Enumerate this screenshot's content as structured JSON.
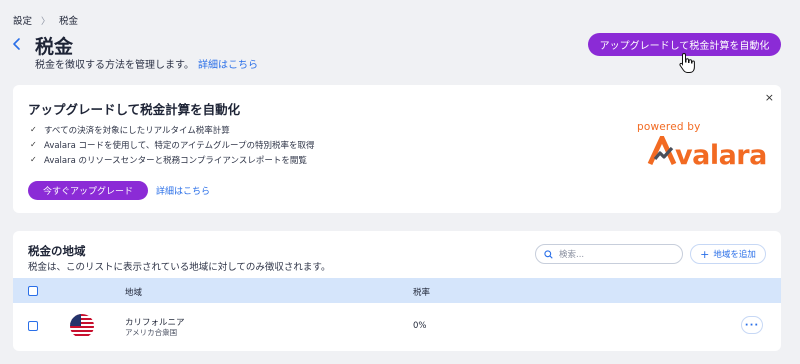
{
  "breadcrumb": {
    "items": [
      "設定",
      "税金"
    ],
    "separator": "〉"
  },
  "header": {
    "title": "税金",
    "subtitle": "税金を徴収する方法を管理します。",
    "learn_more": "詳細はこちら",
    "upgrade_button": "アップグレードして税金計算を自動化"
  },
  "promo": {
    "title": "アップグレードして税金計算を自動化",
    "features": [
      "すべての決済を対象にしたリアルタイム税率計算",
      "Avalara コードを使用して、特定のアイテムグループの特別税率を取得",
      "Avalara のリソースセンターと税務コンプライアンスレポートを閲覧"
    ],
    "upgrade_now": "今すぐアップグレード",
    "learn_more": "詳細はこちら",
    "powered_by": "powered by",
    "brand": "Avalara",
    "close_icon": "×"
  },
  "regions": {
    "title": "税金の地域",
    "description": "税金は、このリストに表示されている地域に対してのみ徴収されます。",
    "search_placeholder": "検索...",
    "add_button": "地域を追加",
    "columns": {
      "region": "地域",
      "rate": "税率"
    },
    "rows": [
      {
        "region": "カリフォルニア",
        "country": "アメリカ合衆国",
        "rate": "0%",
        "flag": "us-flag-icon"
      }
    ]
  },
  "colors": {
    "accent_purple": "#8b2bd6",
    "link_blue": "#2a6fe8",
    "avalara_orange": "#f26a22",
    "table_header": "#d5e5fb",
    "page_bg": "#f0f1f4"
  }
}
